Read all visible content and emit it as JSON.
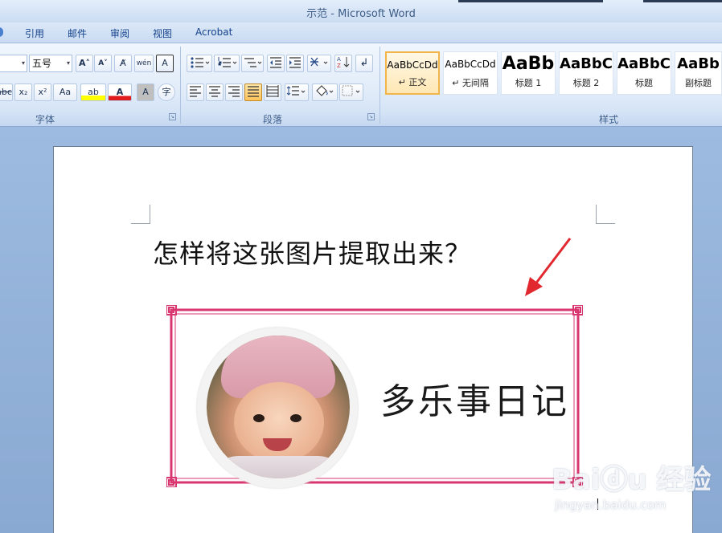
{
  "window": {
    "title": "示范 - Microsoft Word"
  },
  "tabs": [
    "引用",
    "邮件",
    "审阅",
    "视图",
    "Acrobat"
  ],
  "ribbon": {
    "font_group": {
      "label": "字体",
      "font_size": "五号",
      "buttons": {
        "grow": "A˄",
        "shrink": "A˅",
        "clear": "A̸",
        "phonetic": "wén",
        "border_char": "A",
        "strike": "abc",
        "subscript": "x₂",
        "superscript": "x²",
        "case": "Aa",
        "highlight": "ab",
        "font_color": "A",
        "shade_char": "A",
        "enclose": "字"
      }
    },
    "paragraph_group": {
      "label": "段落"
    },
    "styles_group": {
      "label": "样式",
      "styles": [
        {
          "sample": "AaBbCcDd",
          "name": "↵ 正文",
          "selected": true
        },
        {
          "sample": "AaBbCcDd",
          "name": "↵ 无间隔",
          "selected": false
        },
        {
          "sample": "AaBb",
          "name": "标题 1",
          "selected": false
        },
        {
          "sample": "AaBbC",
          "name": "标题 2",
          "selected": false
        },
        {
          "sample": "AaBbC",
          "name": "标题",
          "selected": false
        },
        {
          "sample": "AaBb",
          "name": "副标题",
          "selected": false
        }
      ]
    }
  },
  "document": {
    "question": "怎样将这张图片提取出来？",
    "frame_title": "多乐事日记"
  },
  "watermark": {
    "logo": "Baiⓓu 经验",
    "url": "jingyan.baidu.com"
  },
  "colors": {
    "frame": "#d9366f",
    "arrow": "#e0282e",
    "ribbon_text": "#15428b",
    "highlight_yellow": "#ffff00",
    "font_red": "#e01b1b"
  }
}
